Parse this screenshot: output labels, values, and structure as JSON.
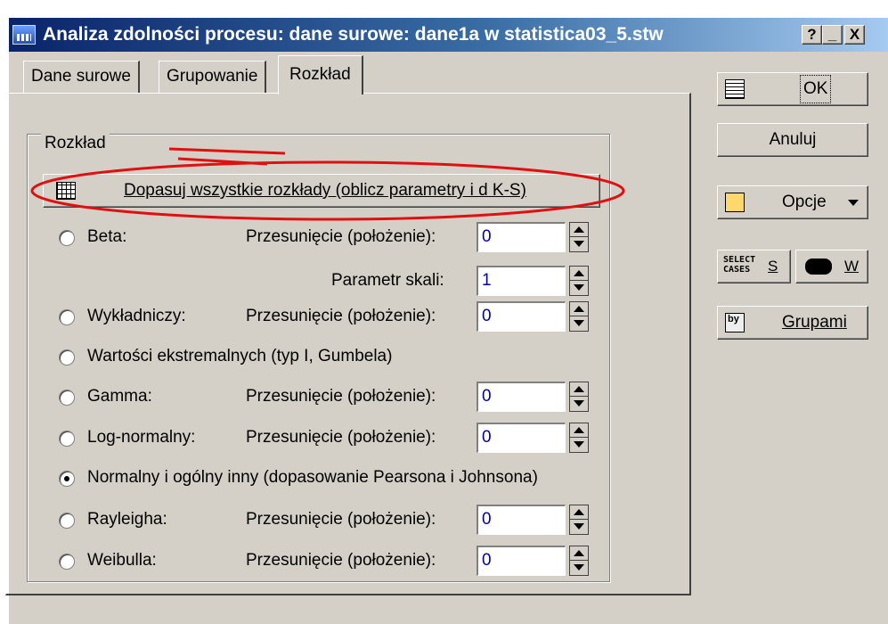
{
  "window": {
    "title": "Analiza zdolności procesu: dane surowe: dane1a w statistica03_5.stw",
    "help_btn": "?",
    "min_btn": "_",
    "close_btn": "X"
  },
  "tabs": [
    {
      "label": "Dane surowe"
    },
    {
      "label": "Grupowanie"
    },
    {
      "label": "Rozkład"
    }
  ],
  "group": {
    "label": "Rozkład",
    "fit_all_button": "Dopasuj wszystkie rozkłady (oblicz parametry i d K-S)"
  },
  "shift_label": "Przesunięcie (położenie):",
  "scale_label": "Parametr skali:",
  "distributions": [
    {
      "label": "Beta:",
      "shift": "0",
      "scale": "1",
      "selected": false
    },
    {
      "label": "Wykładniczy:",
      "shift": "0",
      "selected": false
    },
    {
      "label": "Wartości ekstremalnych (typ I, Gumbela)",
      "selected": false
    },
    {
      "label": "Gamma:",
      "shift": "0",
      "selected": false
    },
    {
      "label": "Log-normalny:",
      "shift": "0",
      "selected": false
    },
    {
      "label": "Normalny i ogólny inny (dopasowanie Pearsona i Johnsona)",
      "selected": true
    },
    {
      "label": "Rayleigha:",
      "shift": "0",
      "selected": false
    },
    {
      "label": "Weibulla:",
      "shift": "0",
      "selected": false
    }
  ],
  "side": {
    "ok": "OK",
    "cancel": "Anuluj",
    "options": "Opcje",
    "select_cases_icon_text": "SELECT CASES",
    "s_label": "S",
    "w_label": "W",
    "by_icon_text": "by",
    "groups": "Grupami"
  },
  "colors": {
    "annotation": "#e01010",
    "title_bar": "#0a246a",
    "field_text": "#0000aa"
  }
}
